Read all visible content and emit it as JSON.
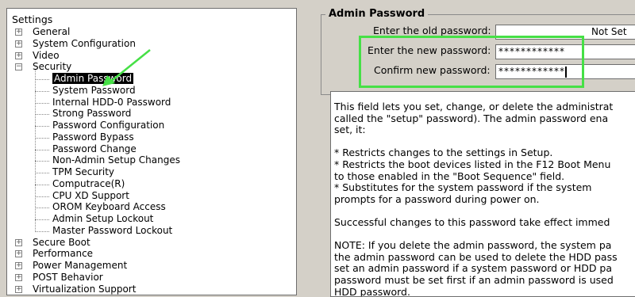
{
  "tree": {
    "title": "Settings",
    "top_before": [
      {
        "label": "General"
      },
      {
        "label": "System Configuration"
      },
      {
        "label": "Video"
      },
      {
        "label": "Security"
      }
    ],
    "security_children": [
      {
        "label": "Admin Password",
        "selected": true
      },
      {
        "label": "System Password"
      },
      {
        "label": "Internal HDD-0 Password"
      },
      {
        "label": "Strong Password"
      },
      {
        "label": "Password Configuration"
      },
      {
        "label": "Password Bypass"
      },
      {
        "label": "Password Change"
      },
      {
        "label": "Non-Admin Setup Changes"
      },
      {
        "label": "TPM Security"
      },
      {
        "label": "Computrace(R)"
      },
      {
        "label": "CPU XD Support"
      },
      {
        "label": "OROM Keyboard Access"
      },
      {
        "label": "Admin Setup Lockout"
      },
      {
        "label": "Master Password Lockout"
      }
    ],
    "top_after": [
      {
        "label": "Secure Boot"
      },
      {
        "label": "Performance"
      },
      {
        "label": "Power Management"
      },
      {
        "label": "POST Behavior"
      },
      {
        "label": "Virtualization Support"
      }
    ],
    "expander_plus": "+",
    "expander_minus": "−"
  },
  "admin_password": {
    "group_title": "Admin Password",
    "old_label": "Enter the old password:",
    "old_value": "Not Set",
    "new_label": "Enter the new password:",
    "new_value": "************",
    "confirm_label": "Confirm new password:",
    "confirm_value": "************"
  },
  "help": {
    "lines": [
      "This field lets you set, change, or delete the administrat",
      "called the \"setup\" password).  The admin password ena",
      "set, it:",
      "",
      "* Restricts changes to the settings in Setup.",
      "* Restricts the boot devices listed in the F12 Boot Menu",
      "   to those enabled in the \"Boot Sequence\" field.",
      "* Substitutes for the system password if the system",
      "   prompts for a password during power on.",
      "",
      "Successful changes to this password take effect immed",
      "",
      "NOTE: If you delete the admin password, the system pa",
      "the admin password can be used to delete the HDD pass",
      "set an admin password if a system password or HDD pa",
      "password must be set first if an admin password is used",
      "HDD password."
    ]
  },
  "colors": {
    "highlight": "#46e046",
    "arrow": "#46e046",
    "selection_bg": "#000000"
  }
}
